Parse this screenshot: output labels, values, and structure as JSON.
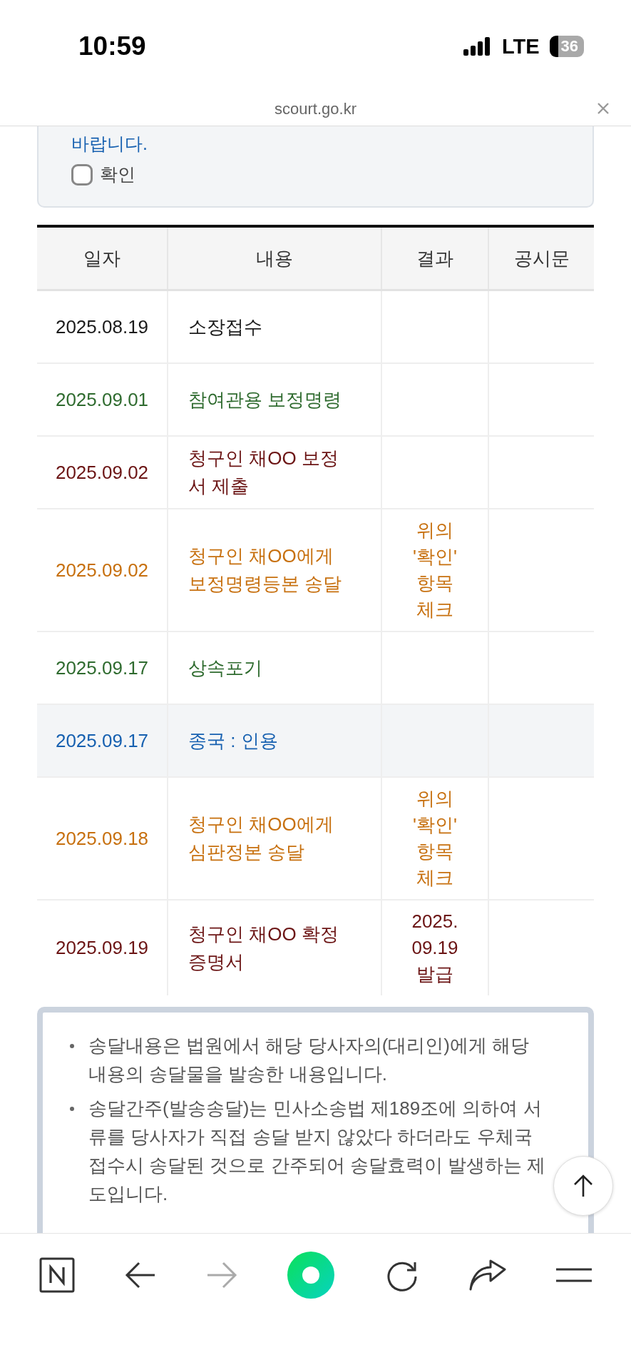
{
  "status_bar": {
    "time": "10:59",
    "network": "LTE",
    "battery": "36"
  },
  "address_bar": {
    "url": "scourt.go.kr"
  },
  "notice": {
    "text": "바랍니다.",
    "checkbox": {
      "label": "확인",
      "checked": false
    }
  },
  "table": {
    "columns": [
      "일자",
      "내용",
      "결과",
      "공시문"
    ],
    "rows": [
      {
        "date": "2025.08.19",
        "content": "소장접수",
        "color": "#1a1a1a",
        "highlighted": false
      },
      {
        "date": "2025.09.01",
        "content": "참여관용 보정명령",
        "color": "#2f6b2f",
        "highlighted": false
      },
      {
        "date": "2025.09.02",
        "content": "청구인 채OO 보정\n서 제출",
        "color": "#6b1414",
        "highlighted": false
      },
      {
        "date": "2025.09.02",
        "content": "청구인 채OO에게\n보정명령등본 송달",
        "result": "위의\n'확인'\n항목\n체크",
        "color": "#c7700f",
        "highlighted": false
      },
      {
        "date": "2025.09.17",
        "content": "상속포기",
        "color": "#2f6b2f",
        "highlighted": false
      },
      {
        "date": "2025.09.17",
        "content": "종국 : 인용",
        "color": "#1660b0",
        "highlighted": true
      },
      {
        "date": "2025.09.18",
        "content": "청구인 채OO에게\n심판정본 송달",
        "result": "위의\n'확인'\n항목\n체크",
        "color": "#c7700f",
        "highlighted": false
      },
      {
        "date": "2025.09.19",
        "content": "청구인 채OO 확정\n증명서",
        "result": "2025.\n09.19\n발급",
        "color": "#6b1414",
        "highlighted": false
      }
    ]
  },
  "notes": [
    "송달내용은 법원에서 해당 당사자의(대리인)에게 해당 내용의 송달물을 발송한 내용입니다.",
    "송달간주(발송송달)는 민사소송법 제189조에 의하여 서류를 당사자가 직접 송달 받지 않았다 하더라도 우체국 접수시 송달된 것으로 간주되어 송달효력이 발생하는 제도입니다."
  ]
}
